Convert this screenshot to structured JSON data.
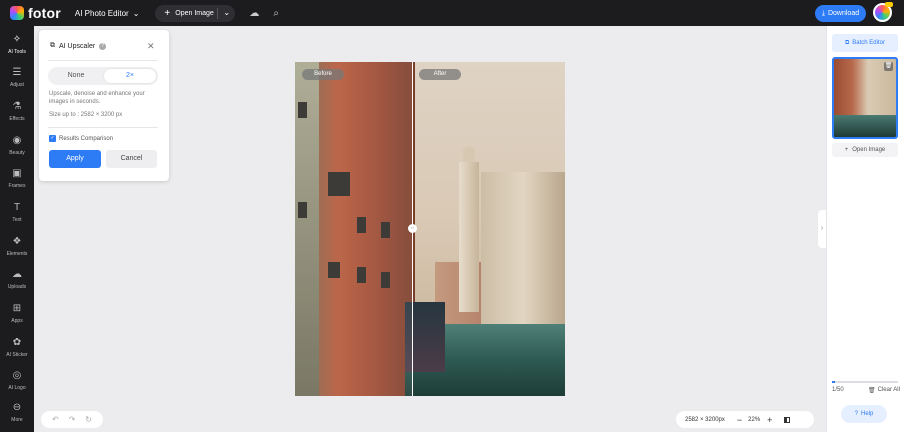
{
  "topbar": {
    "logo_text": "fotor",
    "editor_menu": "AI Photo Editor",
    "open_image": "Open Image",
    "download": "Download"
  },
  "leftnav": {
    "items": [
      {
        "label": "AI Tools",
        "icon": "magic-wand-icon"
      },
      {
        "label": "Adjust",
        "icon": "sliders-icon"
      },
      {
        "label": "Effects",
        "icon": "flask-icon"
      },
      {
        "label": "Beauty",
        "icon": "eye-icon"
      },
      {
        "label": "Frames",
        "icon": "frame-icon"
      },
      {
        "label": "Text",
        "icon": "text-icon"
      },
      {
        "label": "Elements",
        "icon": "shapes-icon"
      },
      {
        "label": "Uploads",
        "icon": "cloud-upload-icon"
      },
      {
        "label": "Apps",
        "icon": "apps-icon"
      },
      {
        "label": "AI Sticker",
        "icon": "sticker-icon"
      },
      {
        "label": "AI Logo",
        "icon": "logo-icon"
      },
      {
        "label": "More",
        "icon": "more-icon"
      }
    ]
  },
  "panel": {
    "title": "AI Upscaler",
    "tabs": [
      "None",
      "2×"
    ],
    "description": "Upscale, denoise and enhance your images in seconds.",
    "size": "Size up to : 2582 × 3200 px",
    "comparison_label": "Results Comparison",
    "apply": "Apply",
    "cancel": "Cancel"
  },
  "canvas": {
    "before_label": "Before",
    "after_label": "After"
  },
  "zoom": {
    "dimensions": "2582 × 3200px",
    "level": "22%"
  },
  "right": {
    "batch_editor": "Batch Editor",
    "open_image": "Open Image",
    "count": "1/50",
    "clear_all": "Clear All",
    "help": "Help"
  },
  "colors": {
    "accent": "#2d7cf5",
    "topbar": "#1c1c1f"
  }
}
